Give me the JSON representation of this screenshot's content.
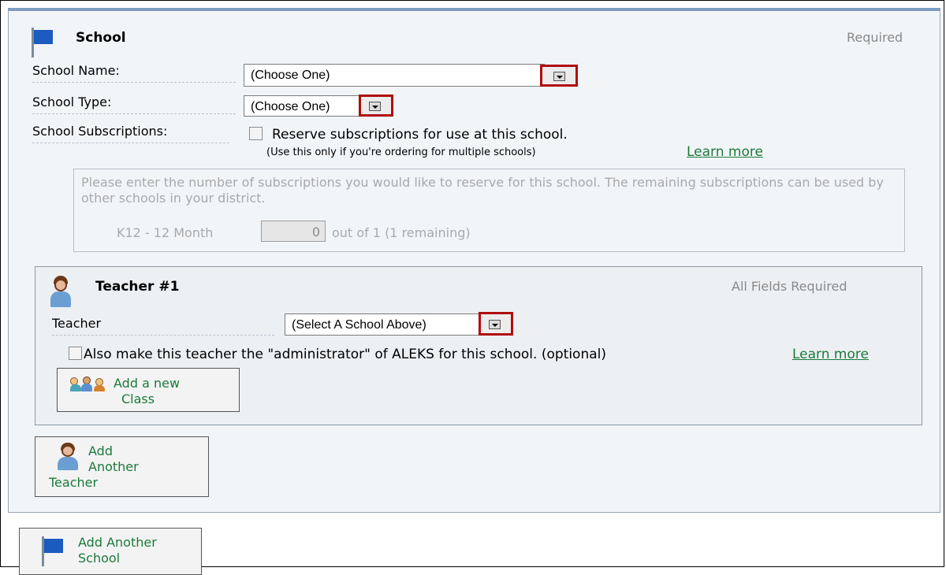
{
  "school": {
    "title": "School",
    "required_note": "Required",
    "name_label": "School Name:",
    "name_value": "(Choose One)",
    "type_label": "School Type:",
    "type_value": "(Choose One)",
    "subscriptions_label": "School Subscriptions:",
    "reserve_text": "Reserve subscriptions for use at this school.",
    "reserve_hint": "(Use this only if you're ordering for multiple schools)",
    "learn_more": "Learn more",
    "reserve_instructions": "Please enter the number of subscriptions you would like to reserve for this school. The remaining subscriptions can be used by other schools in your district.",
    "plan_label": "K12 - 12 Month",
    "plan_value": "0",
    "plan_suffix": "out of 1 (1 remaining)"
  },
  "teacher": {
    "title": "Teacher #1",
    "required_note": "All Fields Required",
    "field_label": "Teacher",
    "field_value": "(Select A School Above)",
    "admin_text": "Also make this teacher the \"administrator\" of ALEKS for this school. (optional)",
    "learn_more": "Learn more",
    "add_class_line1": "Add a new",
    "add_class_line2": "Class"
  },
  "add_teacher": {
    "line1": "Add",
    "line2": "Another",
    "line3": "Teacher"
  },
  "add_school": {
    "line1": "Add Another",
    "line2": "School"
  },
  "icons": {
    "flag": "flag-icon",
    "teacher": "person-icon",
    "class": "group-icon",
    "dropdown": "chevron-down-icon"
  },
  "colors": {
    "accent_link": "#1b7a3a",
    "highlight_border": "#b00c0c",
    "panel_background": "#f2f5f8",
    "flag_blue": "#1c5bbf"
  }
}
